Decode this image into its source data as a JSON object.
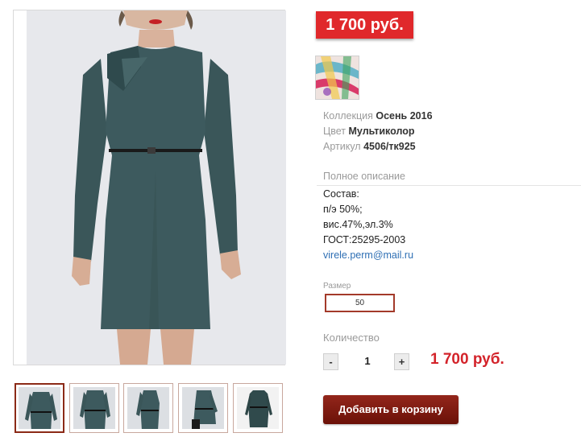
{
  "price_badge": "1 700 руб.",
  "swatch_icon": "multicolor-fabric-swatch",
  "details": [
    {
      "label": "Коллекция",
      "value": "Осень 2016"
    },
    {
      "label": "Цвет",
      "value": "Мультиколор"
    },
    {
      "label": "Артикул",
      "value": "4506/тк925"
    }
  ],
  "description": {
    "title": "Полное описание",
    "lines": [
      "Состав:",
      "п/э 50%;",
      "вис.47%,эл.3%",
      "ГОСТ:25295-2003"
    ],
    "email": "virele.perm@mail.ru"
  },
  "size": {
    "label": "Размер",
    "value": "50"
  },
  "quantity": {
    "label": "Количество",
    "minus": "-",
    "value": "1",
    "plus": "+"
  },
  "total_price": "1 700 руб.",
  "add_to_cart": "Добавить в корзину",
  "colors": {
    "accent": "#e0282b",
    "button": "#7d1a10",
    "dress": "#3d5a5e",
    "link": "#2e6fb4"
  }
}
